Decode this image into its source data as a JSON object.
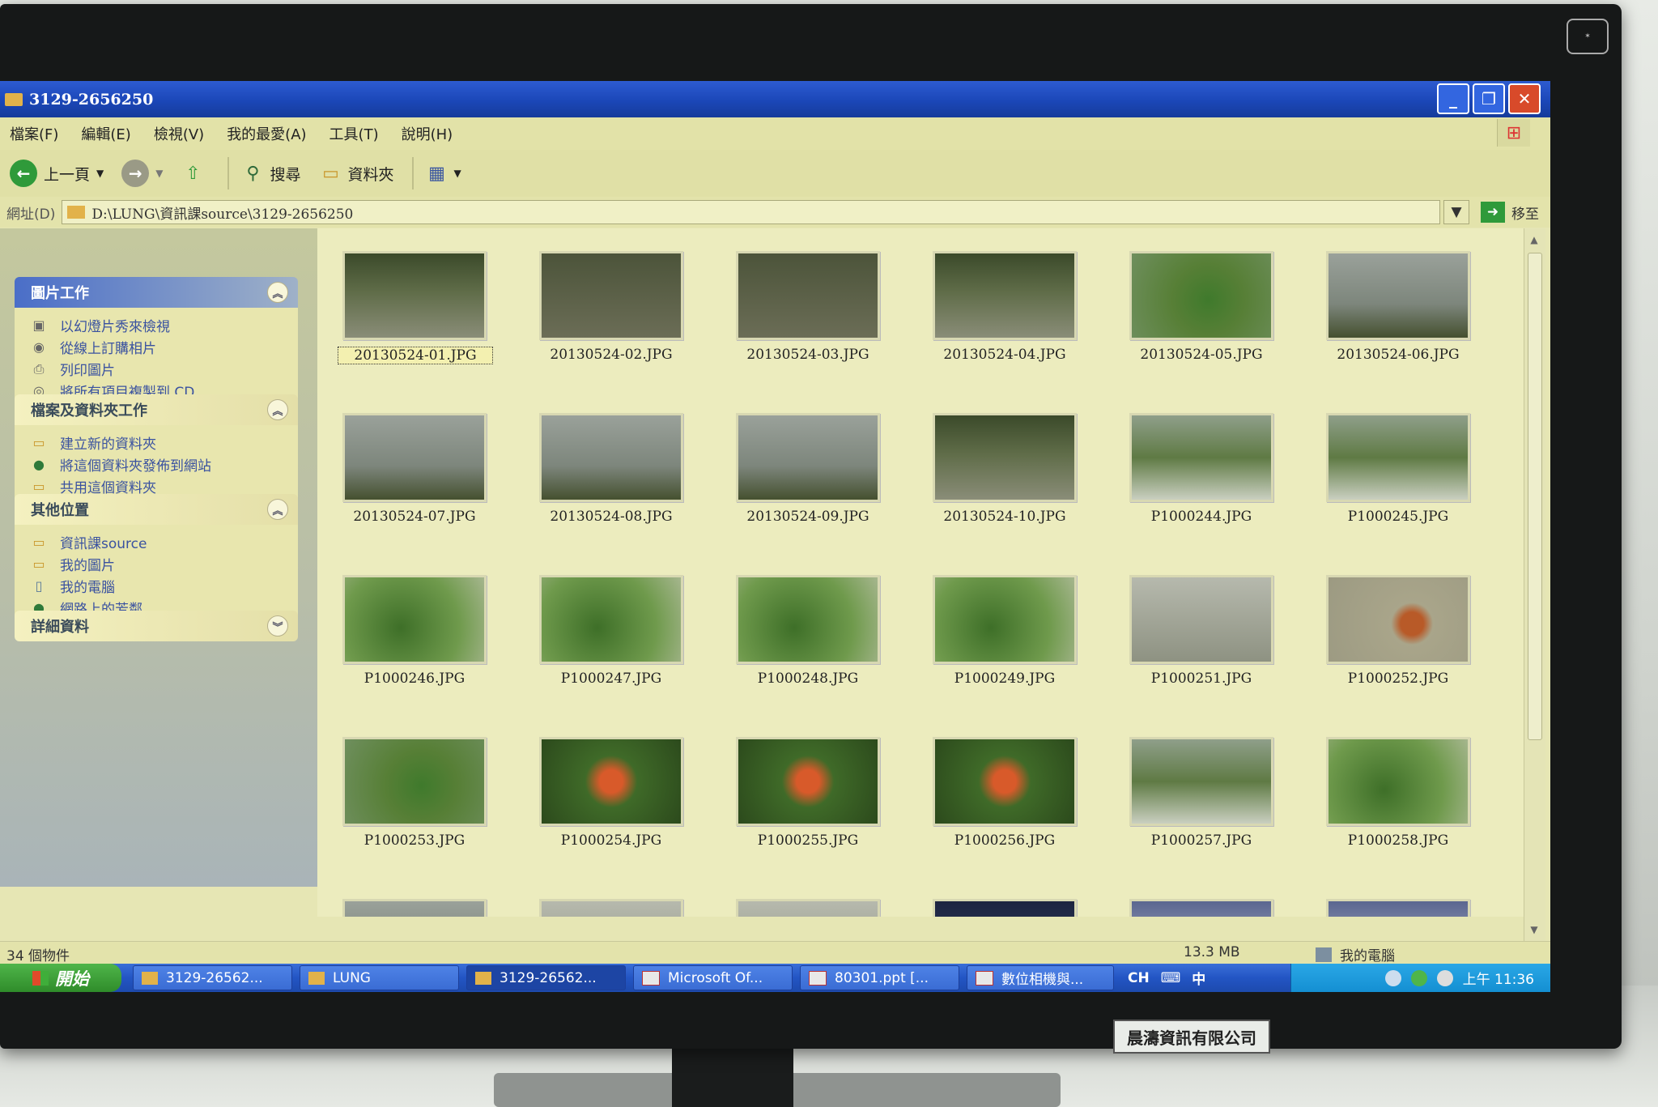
{
  "window": {
    "title": "3129-2656250"
  },
  "menu": [
    "檔案(F)",
    "編輯(E)",
    "檢視(V)",
    "我的最愛(A)",
    "工具(T)",
    "說明(H)"
  ],
  "toolbar": {
    "back": "上一頁",
    "search": "搜尋",
    "folders": "資料夾"
  },
  "address": {
    "label": "網址(D)",
    "path": "D:\\LUNG\\資訊課source\\3129-2656250",
    "go": "移至"
  },
  "panels": {
    "picture_tasks": {
      "title": "圖片工作",
      "items": [
        "以幻燈片秀來檢視",
        "從線上訂購相片",
        "列印圖片",
        "將所有項目複製到 CD"
      ]
    },
    "file_tasks": {
      "title": "檔案及資料夾工作",
      "items": [
        "建立新的資料夾",
        "將這個資料夾發佈到網站",
        "共用這個資料夾"
      ]
    },
    "other_places": {
      "title": "其他位置",
      "items": [
        "資訊課source",
        "我的圖片",
        "我的電腦",
        "網路上的芳鄰"
      ]
    },
    "details": {
      "title": "詳細資料"
    }
  },
  "files": [
    "20130524-01.JPG",
    "20130524-02.JPG",
    "20130524-03.JPG",
    "20130524-04.JPG",
    "20130524-05.JPG",
    "20130524-06.JPG",
    "20130524-07.JPG",
    "20130524-08.JPG",
    "20130524-09.JPG",
    "20130524-10.JPG",
    "P1000244.JPG",
    "P1000245.JPG",
    "P1000246.JPG",
    "P1000247.JPG",
    "P1000248.JPG",
    "P1000249.JPG",
    "P1000251.JPG",
    "P1000252.JPG",
    "P1000253.JPG",
    "P1000254.JPG",
    "P1000255.JPG",
    "P1000256.JPG",
    "P1000257.JPG",
    "P1000258.JPG"
  ],
  "status": {
    "count": "34 個物件",
    "size": "13.3 MB",
    "location": "我的電腦"
  },
  "taskbar": {
    "start": "開始",
    "tasks": [
      "3129-26562...",
      "LUNG",
      "3129-26562...",
      "Microsoft Of...",
      "80301.ppt [...",
      "數位相機與..."
    ],
    "lang": [
      "CH",
      "中"
    ],
    "clock": "上午 11:36"
  },
  "monitor": {
    "vendor_label": "晨濤資訊有限公司"
  }
}
